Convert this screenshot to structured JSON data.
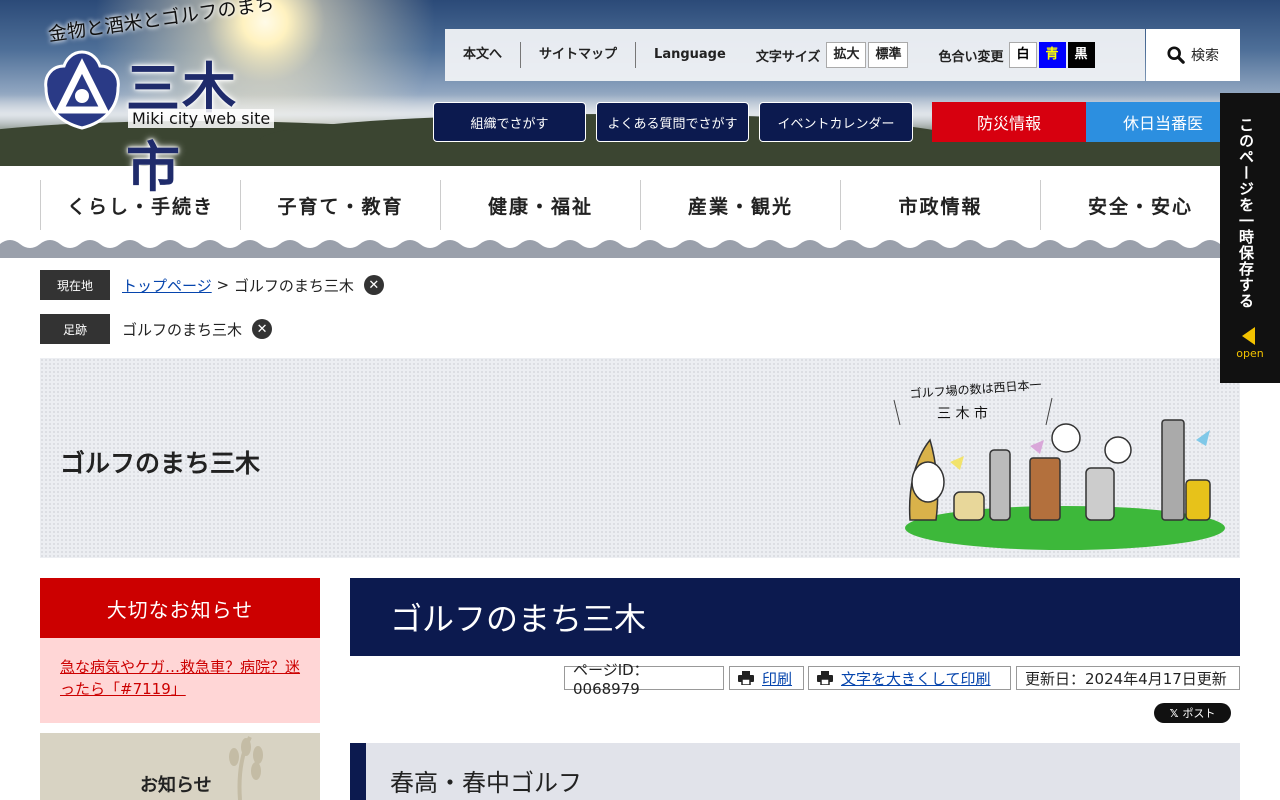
{
  "header": {
    "tagline": "金物と酒米とゴルフのまち",
    "city_name": "三木市",
    "subtitle": "Miki city web site",
    "util_links": [
      "本文へ",
      "サイトマップ",
      "Language"
    ],
    "font_size_label": "文字サイズ",
    "font_size_options": [
      "拡大",
      "標準"
    ],
    "color_label": "色合い変更",
    "color_options": [
      "白",
      "青",
      "黒"
    ],
    "search_label": "検索",
    "quick_links": [
      "組織でさがす",
      "よくある質問でさがす",
      "イベントカレンダー"
    ],
    "disaster_label": "防災情報",
    "holiday_label": "休日当番医"
  },
  "global_nav": [
    "くらし・手続き",
    "子育て・教育",
    "健康・福祉",
    "産業・観光",
    "市政情報",
    "安全・安心"
  ],
  "breadcrumb": {
    "current_label": "現在地",
    "home_link": "トップページ",
    "separator": " > ",
    "current_page": "ゴルフのまち三木",
    "history_label": "足跡",
    "history_item": "ゴルフのまち三木"
  },
  "banner": {
    "title": "ゴルフのまち三木",
    "illustration_text1": "ゴルフ場の数は西日本一",
    "illustration_text2": "三 木 市"
  },
  "sidebar": {
    "notice_title": "大切なお知らせ",
    "notice_link": "急な病気やケガ…救急車？病院？迷ったら「#7119」",
    "news_title": "お知らせ"
  },
  "main": {
    "title": "ゴルフのまち三木",
    "page_id": "ページID：0068979",
    "print_label": "印刷",
    "print_large_label": "文字を大きくして印刷",
    "updated": "更新日：2024年4月17日更新",
    "x_post_label": "ポスト",
    "section_title": "春高・春中ゴルフ"
  },
  "save_panel": {
    "label": "このページを一時保存する",
    "open_label": "open"
  },
  "colors": {
    "navy": "#0c1a4f",
    "alert_red": "#d7000f",
    "holiday_blue": "#2c8fe0",
    "notice_bg": "#ffd6d6"
  }
}
